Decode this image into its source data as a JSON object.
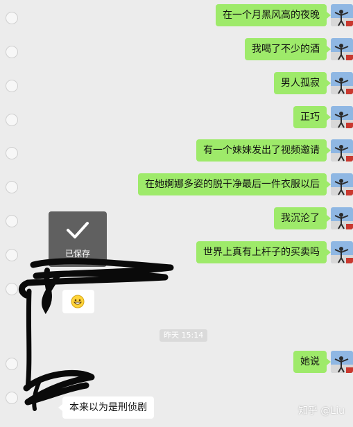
{
  "colors": {
    "background": "#ececec",
    "outgoing_bubble": "#9eea6a",
    "incoming_bubble": "#ffffff",
    "toast": "#4c4c4c"
  },
  "messages": [
    {
      "side": "out",
      "text": "在一个月黑风高的夜晚"
    },
    {
      "side": "out",
      "text": "我喝了不少的酒"
    },
    {
      "side": "out",
      "text": "男人孤寂"
    },
    {
      "side": "out",
      "text": "正巧"
    },
    {
      "side": "out",
      "text": "有一个妹妹发出了视频邀请"
    },
    {
      "side": "out",
      "text": "在她婀娜多姿的脱干净最后一件衣服以后"
    },
    {
      "side": "out",
      "text": "我沉沦了"
    },
    {
      "side": "out",
      "text": "世界上真有上杆子的买卖吗"
    },
    {
      "side": "in",
      "emoji": "grinning-face-icon"
    },
    {
      "side": "out",
      "text": "她说"
    },
    {
      "side": "in",
      "text": "本来以为是刑侦剧"
    }
  ],
  "timestamp": "昨天 15:14",
  "toast": {
    "label": "已保存",
    "icon": "checkmark-icon"
  },
  "watermark": "知乎 @Liu"
}
